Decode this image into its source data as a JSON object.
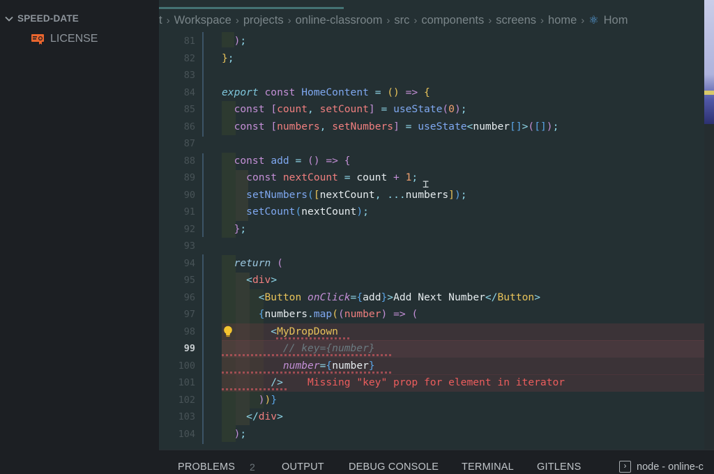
{
  "sidebar": {
    "section_title": "SPEED-DATE",
    "files": [
      {
        "name": "LICENSE",
        "icon": "license-icon",
        "icon_color": "#e8652e"
      }
    ]
  },
  "breadcrumb": {
    "items": [
      "t",
      "Workspace",
      "projects",
      "online-classroom",
      "src",
      "components",
      "screens",
      "home"
    ],
    "last": {
      "icon": "react-icon",
      "label": "Hom"
    }
  },
  "editor": {
    "active_line": 99,
    "line_numbers": [
      81,
      82,
      83,
      84,
      85,
      86,
      87,
      88,
      89,
      90,
      91,
      92,
      93,
      94,
      95,
      96,
      97,
      98,
      99,
      100,
      101,
      102,
      103,
      104
    ],
    "lines": [
      [
        {
          "t": "  ",
          "c": ""
        },
        {
          "t": ")",
          "c": "br2"
        },
        {
          "t": ";",
          "c": "punc"
        }
      ],
      [
        {
          "t": "}",
          "c": "br1"
        },
        {
          "t": ";",
          "c": "punc"
        }
      ],
      [],
      [
        {
          "t": "export",
          "c": "kwi"
        },
        {
          "t": " ",
          "c": ""
        },
        {
          "t": "const",
          "c": "kw"
        },
        {
          "t": " ",
          "c": ""
        },
        {
          "t": "HomeContent",
          "c": "fn"
        },
        {
          "t": " = ",
          "c": "punc"
        },
        {
          "t": "()",
          "c": "br1"
        },
        {
          "t": " => ",
          "c": "kw"
        },
        {
          "t": "{",
          "c": "br1"
        }
      ],
      [
        {
          "t": "  ",
          "c": ""
        },
        {
          "t": "const",
          "c": "kw"
        },
        {
          "t": " ",
          "c": ""
        },
        {
          "t": "[",
          "c": "br2"
        },
        {
          "t": "count",
          "c": "var"
        },
        {
          "t": ", ",
          "c": "punc"
        },
        {
          "t": "setCount",
          "c": "var"
        },
        {
          "t": "]",
          "c": "br2"
        },
        {
          "t": " = ",
          "c": "punc"
        },
        {
          "t": "useState",
          "c": "fn"
        },
        {
          "t": "(",
          "c": "br2"
        },
        {
          "t": "0",
          "c": "num"
        },
        {
          "t": ")",
          "c": "br2"
        },
        {
          "t": ";",
          "c": "punc"
        }
      ],
      [
        {
          "t": "  ",
          "c": ""
        },
        {
          "t": "const",
          "c": "kw"
        },
        {
          "t": " ",
          "c": ""
        },
        {
          "t": "[",
          "c": "br2"
        },
        {
          "t": "numbers",
          "c": "var"
        },
        {
          "t": ", ",
          "c": "punc"
        },
        {
          "t": "setNumbers",
          "c": "var"
        },
        {
          "t": "]",
          "c": "br2"
        },
        {
          "t": " = ",
          "c": "punc"
        },
        {
          "t": "useState",
          "c": "fn"
        },
        {
          "t": "<",
          "c": "punc"
        },
        {
          "t": "number",
          "c": "txt"
        },
        {
          "t": "[]",
          "c": "br3"
        },
        {
          "t": ">",
          "c": "punc"
        },
        {
          "t": "(",
          "c": "br2"
        },
        {
          "t": "[]",
          "c": "br3"
        },
        {
          "t": ")",
          "c": "br2"
        },
        {
          "t": ";",
          "c": "punc"
        }
      ],
      [],
      [
        {
          "t": "  ",
          "c": ""
        },
        {
          "t": "const",
          "c": "kw"
        },
        {
          "t": " ",
          "c": ""
        },
        {
          "t": "add",
          "c": "fn"
        },
        {
          "t": " = ",
          "c": "punc"
        },
        {
          "t": "()",
          "c": "br2"
        },
        {
          "t": " => ",
          "c": "kw"
        },
        {
          "t": "{",
          "c": "br2"
        }
      ],
      [
        {
          "t": "    ",
          "c": ""
        },
        {
          "t": "const",
          "c": "kw"
        },
        {
          "t": " ",
          "c": ""
        },
        {
          "t": "nextCount",
          "c": "var"
        },
        {
          "t": " = ",
          "c": "punc"
        },
        {
          "t": "count",
          "c": "txt"
        },
        {
          "t": " + ",
          "c": "kw"
        },
        {
          "t": "1",
          "c": "num"
        },
        {
          "t": ";",
          "c": "punc"
        }
      ],
      [
        {
          "t": "    ",
          "c": ""
        },
        {
          "t": "setNumbers",
          "c": "fn"
        },
        {
          "t": "(",
          "c": "br3"
        },
        {
          "t": "[",
          "c": "br1"
        },
        {
          "t": "nextCount",
          "c": "txt"
        },
        {
          "t": ", ",
          "c": "punc"
        },
        {
          "t": "...",
          "c": "punc"
        },
        {
          "t": "numbers",
          "c": "txt"
        },
        {
          "t": "]",
          "c": "br1"
        },
        {
          "t": ")",
          "c": "br3"
        },
        {
          "t": ";",
          "c": "punc"
        }
      ],
      [
        {
          "t": "    ",
          "c": ""
        },
        {
          "t": "setCount",
          "c": "fn"
        },
        {
          "t": "(",
          "c": "br3"
        },
        {
          "t": "nextCount",
          "c": "txt"
        },
        {
          "t": ")",
          "c": "br3"
        },
        {
          "t": ";",
          "c": "punc"
        }
      ],
      [
        {
          "t": "  ",
          "c": ""
        },
        {
          "t": "}",
          "c": "br2"
        },
        {
          "t": ";",
          "c": "punc"
        }
      ],
      [],
      [
        {
          "t": "  ",
          "c": ""
        },
        {
          "t": "return",
          "c": "ret"
        },
        {
          "t": " ",
          "c": ""
        },
        {
          "t": "(",
          "c": "br2"
        }
      ],
      [
        {
          "t": "    ",
          "c": ""
        },
        {
          "t": "<",
          "c": "punc"
        },
        {
          "t": "div",
          "c": "tagh"
        },
        {
          "t": ">",
          "c": "punc"
        }
      ],
      [
        {
          "t": "      ",
          "c": ""
        },
        {
          "t": "<",
          "c": "punc"
        },
        {
          "t": "Button",
          "c": "tag"
        },
        {
          "t": " ",
          "c": ""
        },
        {
          "t": "onClick",
          "c": "attr"
        },
        {
          "t": "=",
          "c": "punc"
        },
        {
          "t": "{",
          "c": "br3"
        },
        {
          "t": "add",
          "c": "txt"
        },
        {
          "t": "}",
          "c": "br3"
        },
        {
          "t": ">",
          "c": "punc"
        },
        {
          "t": "Add Next Number",
          "c": "txt"
        },
        {
          "t": "</",
          "c": "punc"
        },
        {
          "t": "Button",
          "c": "tag"
        },
        {
          "t": ">",
          "c": "punc"
        }
      ],
      [
        {
          "t": "      ",
          "c": ""
        },
        {
          "t": "{",
          "c": "br3"
        },
        {
          "t": "numbers",
          "c": "txt"
        },
        {
          "t": ".",
          "c": "punc"
        },
        {
          "t": "map",
          "c": "fn"
        },
        {
          "t": "(",
          "c": "br1"
        },
        {
          "t": "(",
          "c": "br2"
        },
        {
          "t": "number",
          "c": "var"
        },
        {
          "t": ")",
          "c": "br2"
        },
        {
          "t": " => ",
          "c": "kw"
        },
        {
          "t": "(",
          "c": "br2"
        }
      ],
      [
        {
          "t": "        ",
          "c": ""
        },
        {
          "t": "<",
          "c": "punc"
        },
        {
          "t": "MyDropDown",
          "c": "tag"
        }
      ],
      [
        {
          "t": "          ",
          "c": ""
        },
        {
          "t": "// key={number}",
          "c": "cmt"
        }
      ],
      [
        {
          "t": "          ",
          "c": ""
        },
        {
          "t": "number",
          "c": "attr"
        },
        {
          "t": "=",
          "c": "punc"
        },
        {
          "t": "{",
          "c": "br3"
        },
        {
          "t": "number",
          "c": "txt"
        },
        {
          "t": "}",
          "c": "br3"
        }
      ],
      [
        {
          "t": "        ",
          "c": ""
        },
        {
          "t": "/>",
          "c": "punc"
        },
        {
          "t": "    ",
          "c": ""
        },
        {
          "t": "Missing \"key\" prop for element in iterator",
          "c": "errmsg"
        }
      ],
      [
        {
          "t": "      ",
          "c": ""
        },
        {
          "t": ")",
          "c": "br2"
        },
        {
          "t": ")",
          "c": "br1"
        },
        {
          "t": "}",
          "c": "br3"
        }
      ],
      [
        {
          "t": "    ",
          "c": ""
        },
        {
          "t": "</",
          "c": "punc"
        },
        {
          "t": "div",
          "c": "tagh"
        },
        {
          "t": ">",
          "c": "punc"
        }
      ],
      [
        {
          "t": "  ",
          "c": ""
        },
        {
          "t": ")",
          "c": "br2"
        },
        {
          "t": ";",
          "c": "punc"
        }
      ]
    ],
    "diagnostic": {
      "line": 101,
      "message": "Missing \"key\" prop for element in iterator",
      "severity": "error"
    }
  },
  "panel": {
    "tabs": [
      {
        "label": "PROBLEMS",
        "count": "2"
      },
      {
        "label": "OUTPUT"
      },
      {
        "label": "DEBUG CONSOLE"
      },
      {
        "label": "TERMINAL"
      },
      {
        "label": "GITLENS"
      }
    ],
    "terminal_label": "node - online-c"
  }
}
